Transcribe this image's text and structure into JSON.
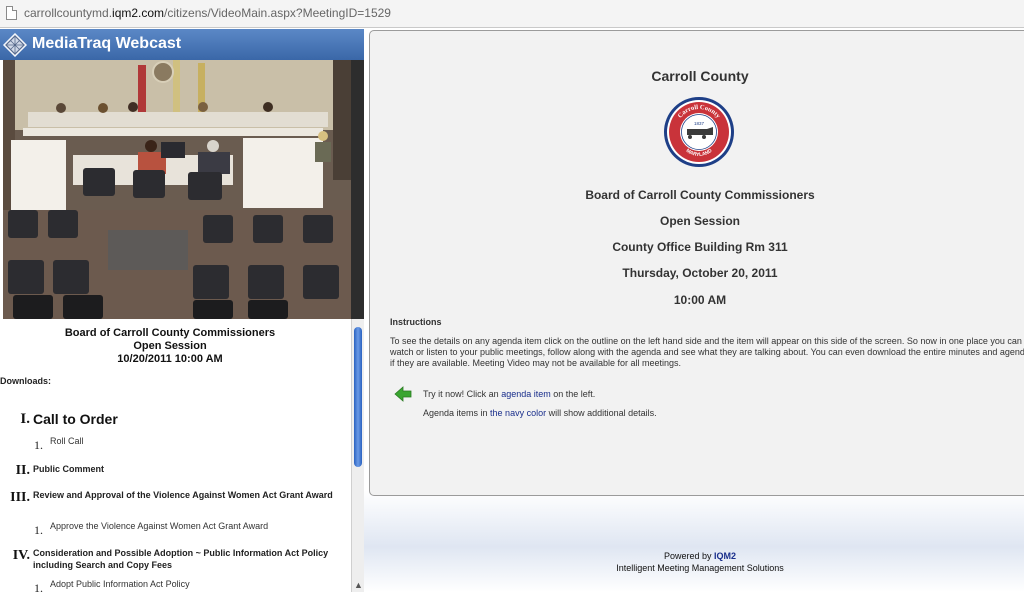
{
  "browser": {
    "url_prefix": "carrollcountymd.",
    "url_domain": "iqm2.com",
    "url_path": "/citizens/VideoMain.aspx?MeetingID=1529"
  },
  "app": {
    "title": "MediaTraq Webcast"
  },
  "meeting": {
    "body": "Board of Carroll County Commissioners",
    "session": "Open Session",
    "datetime": "10/20/2011 10:00 AM",
    "downloads_label": "Downloads:"
  },
  "agenda": [
    {
      "num": "I.",
      "title": "Call to Order",
      "subs": [
        {
          "num": "1.",
          "title": "Roll Call"
        }
      ]
    },
    {
      "num": "II.",
      "title": "Public Comment",
      "subs": []
    },
    {
      "num": "III.",
      "title": "Review and Approval of the Violence Against Women Act Grant Award",
      "subs": [
        {
          "num": "1.",
          "title": "Approve the Violence Against Women Act Grant Award"
        }
      ]
    },
    {
      "num": "IV.",
      "title": "Consideration and Possible Adoption ~ Public Information Act Policy including Search and Copy Fees",
      "subs": [
        {
          "num": "1.",
          "title": "Adopt Public Information Act Policy"
        }
      ]
    }
  ],
  "detail": {
    "county": "Carroll County",
    "seal_top": "Carroll County",
    "seal_year": "1837",
    "seal_bottom": "MARYLAND",
    "board": "Board of Carroll County Commissioners",
    "session": "Open Session",
    "location": "County Office Building Rm 311",
    "date": "Thursday, October 20, 2011",
    "time": "10:00 AM",
    "instructions_title": "Instructions",
    "instructions_text": "To see the details on any agenda item click on the outline on the left hand side and the item will appear on this side of the screen. So now in one place you can watch or listen to your public meetings, follow along with the agenda and see what they are talking about. You can even download the entire minutes and agenda if they are available. Meeting Video may not be available for all meetings.",
    "tip1_pre": "Try it now! Click an ",
    "tip1_link": "agenda item",
    "tip1_post": " on the left.",
    "tip2_pre": "Agenda items in ",
    "tip2_link": "the navy color",
    "tip2_post": " will show additional details."
  },
  "footer": {
    "powered_pre": "Powered by ",
    "powered_brand": "IQM2",
    "tagline": "Intelligent Meeting Management Solutions"
  },
  "colors": {
    "header_blue": "#3a67a8",
    "navy_link": "#1a2f8c",
    "arrow_green": "#3aa530"
  }
}
